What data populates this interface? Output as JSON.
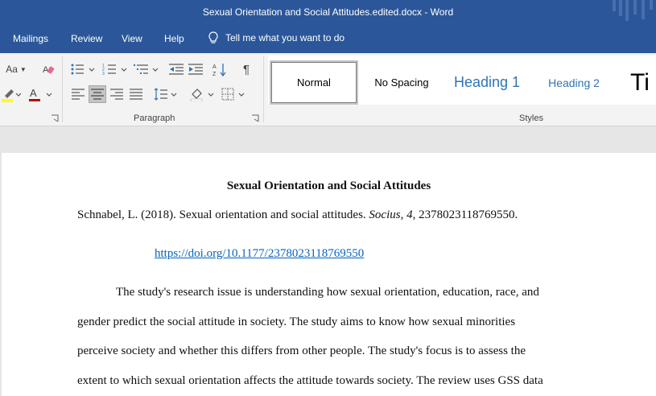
{
  "window": {
    "title": "Sexual Orientation and Social Attitudes.edited.docx  -  Word"
  },
  "menu": {
    "tabs": [
      "Mailings",
      "Review",
      "View",
      "Help"
    ],
    "tell_me": "Tell me what you want to do"
  },
  "ribbon": {
    "paragraph_group_label": "Paragraph",
    "styles_group_label": "Styles",
    "font_case_label": "Aa",
    "styles": [
      "Normal",
      "No Spacing",
      "Heading 1",
      "Heading 2",
      "Ti"
    ],
    "colors": {
      "heading": "#2e74b5",
      "highlight": "#ffff00",
      "font_color": "#c00000",
      "title_bar": "#2b579a"
    }
  },
  "document": {
    "title": "Sexual Orientation and Social Attitudes",
    "citation": {
      "prefix": "Schnabel, L. (2018). Sexual orientation and social attitudes.",
      "journal": "Socius",
      "sep1": ", ",
      "volume": "4",
      "suffix": ", 2378023118769550."
    },
    "doi": "https://doi.org/10.1177/2378023118769550",
    "paragraph_lines": [
      "The study's research issue is understanding how sexual orientation, education, race, and",
      "gender predict the social attitude in society.  The study aims to know how sexual minorities",
      "perceive society and whether this differs from other people. The study's focus is to assess the",
      "extent to which sexual orientation affects the attitude towards society. The review uses GSS data"
    ]
  }
}
